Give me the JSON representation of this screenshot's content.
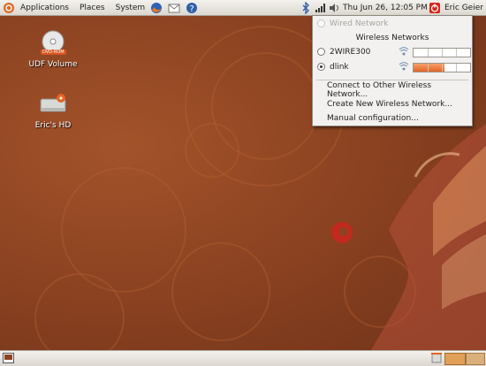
{
  "top_panel": {
    "menus": [
      "Applications",
      "Places",
      "System"
    ],
    "clock": "Thu Jun 26, 12:05 PM",
    "user": "Eric Geier"
  },
  "desktop": {
    "icons": [
      {
        "label": "UDF Volume",
        "badge": "DVD-ROM"
      },
      {
        "label": "Eric's HD"
      }
    ]
  },
  "network_menu": {
    "wired": "Wired Network",
    "wireless_header": "Wireless Networks",
    "networks": [
      {
        "name": "2WIRE300",
        "selected": false,
        "signal": 0
      },
      {
        "name": "dlink",
        "selected": true,
        "signal": 0.55
      }
    ],
    "actions": [
      "Connect to Other Wireless Network...",
      "Create New Wireless Network...",
      "Manual configuration..."
    ]
  },
  "colors": {
    "desktop_bg": "#8c4321",
    "accent": "#e36525"
  }
}
